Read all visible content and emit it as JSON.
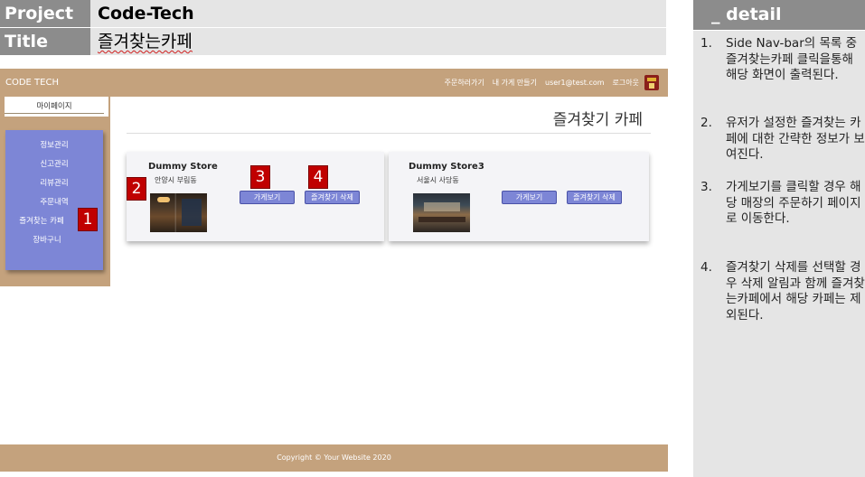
{
  "header": {
    "project_label": "Project",
    "project_value": "Code-Tech",
    "title_label": "Title",
    "title_value": "즐겨찾는카페"
  },
  "detail": {
    "title": "_ detail",
    "items": [
      {
        "num": "1.",
        "text": "Side Nav-bar의 목록 중 즐겨찾는카페 클릭을통해 해당 화면이 출력된다."
      },
      {
        "num": "2.",
        "text": "유저가 설정한 즐겨찾는 카페에 대한 간략한 정보가 보여진다."
      },
      {
        "num": "3.",
        "text": "가게보기를 클릭할 경우 해당 매장의 주문하기 페이지로 이동한다."
      },
      {
        "num": "4.",
        "text": "즐겨찾기 삭제를 선택할 경우 삭제 알림과 함께 즐겨찾는카페에서 해당 카페는 제외된다."
      }
    ]
  },
  "site": {
    "brand": "CODE TECH",
    "nav": [
      "주문하러가기",
      "내 가게 만들기",
      "user1@test.com",
      "로그아웃"
    ],
    "mypage": "마이페이지",
    "menu": [
      "정보관리",
      "신고관리",
      "리뷰관리",
      "주문내역",
      "즐겨찾는 카페",
      "장바구니"
    ],
    "page_title": "즐겨찾기 카페",
    "stores": [
      {
        "name": "Dummy Store",
        "address": "안양시 부림동",
        "view_label": "가게보기",
        "delete_label": "즐겨찾기 삭제"
      },
      {
        "name": "Dummy Store3",
        "address": "서울시 사당동",
        "view_label": "가게보기",
        "delete_label": "즐겨찾기 삭제"
      }
    ],
    "footer": "Copyright © Your Website 2020"
  },
  "markers": [
    "1",
    "2",
    "3",
    "4"
  ],
  "colors": {
    "header_label_bg": "#8c8c8c",
    "header_value_bg": "#e5e5e5",
    "nav_bg": "#c4a27d",
    "side_menu_bg": "#7d86d6",
    "button_bg": "#7d86d6",
    "marker_bg": "#c00000"
  }
}
